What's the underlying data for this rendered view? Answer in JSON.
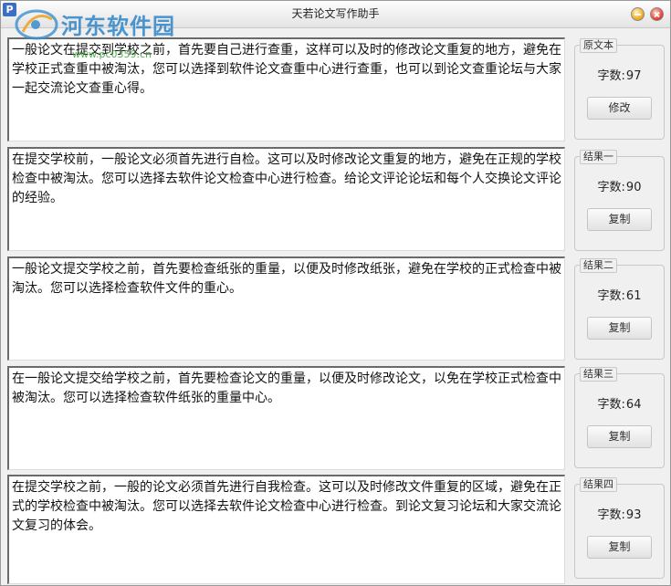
{
  "window": {
    "title": "天若论文写作助手",
    "app_icon": "P"
  },
  "watermark": {
    "text": "河东软件园",
    "url": "www.pc0359.cn"
  },
  "rows": [
    {
      "text": "一般论文在提交到学校之前，首先要自己进行查重，这样可以及时的修改论文重复的地方，避免在学校正式查重中被淘汰，您可以选择到软件论文查重中心进行查重，也可以到论文查重论坛与大家一起交流论文查重心得。",
      "group_label": "原文本",
      "count_label": "字数:",
      "count": "97",
      "button_label": "修改"
    },
    {
      "text": "在提交学校前，一般论文必须首先进行自检。这可以及时修改论文重复的地方，避免在正规的学校检查中被淘汰。您可以选择去软件论文检查中心进行检查。给论文评论论坛和每个人交换论文评论的经验。",
      "group_label": "结果一",
      "count_label": "字数:",
      "count": "90",
      "button_label": "复制"
    },
    {
      "text": "一般论文提交学校之前，首先要检查纸张的重量，以便及时修改纸张，避免在学校的正式检查中被淘汰。您可以选择检查软件文件的重心。",
      "group_label": "结果二",
      "count_label": "字数:",
      "count": "61",
      "button_label": "复制"
    },
    {
      "text": "在一般论文提交给学校之前，首先要检查论文的重量，以便及时修改论文，以免在学校正式检查中被淘汰。您可以选择检查软件纸张的重量中心。",
      "group_label": "结果三",
      "count_label": "字数:",
      "count": "64",
      "button_label": "复制"
    },
    {
      "text": "在提交学校之前，一般的论文必须首先进行自我检查。这可以及时修改文件重复的区域，避免在正式的学校检查中被淘汰。您可以选择去软件论文检查中心进行检查。到论文复习论坛和大家交流论文复习的体会。",
      "group_label": "结果四",
      "count_label": "字数:",
      "count": "93",
      "button_label": "复制"
    }
  ]
}
